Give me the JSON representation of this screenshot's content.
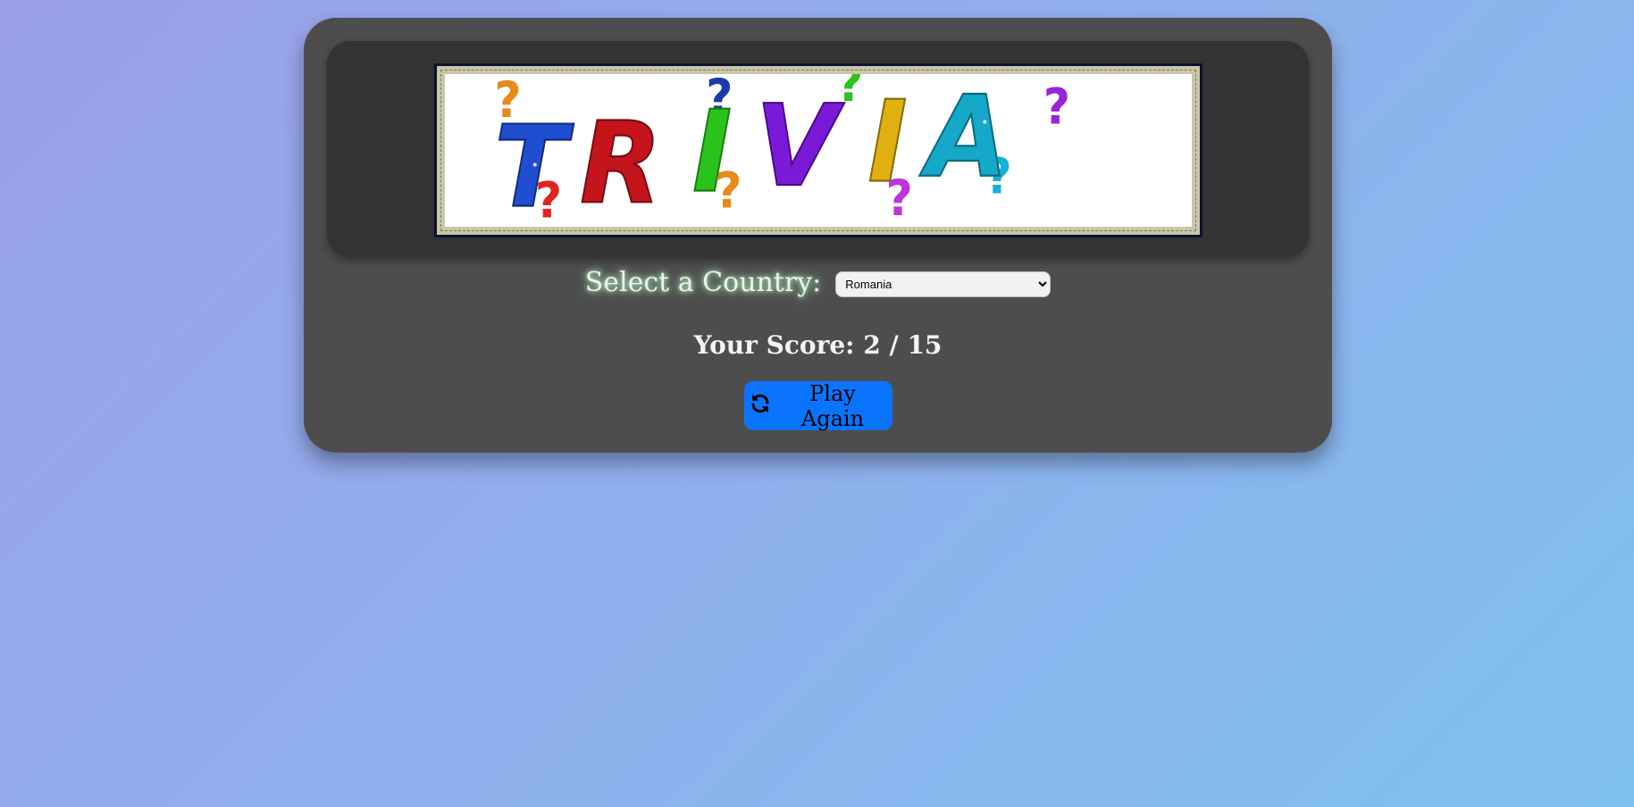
{
  "logo": {
    "text": "TRIVIA",
    "letter_colors": [
      "#1f4fd0",
      "#c4141c",
      "#2cc21c",
      "#7a1ad8",
      "#e0b010",
      "#15a8c8"
    ]
  },
  "country": {
    "label": "Select a Country:",
    "selected": "Romania",
    "options": [
      "Romania"
    ]
  },
  "score": {
    "text": "Your Score: 2 / 15"
  },
  "play_again": {
    "label": "Play Again",
    "icon": "refresh-icon"
  },
  "colors": {
    "button": "#0a74ff",
    "card": "#4d4d4d",
    "banner": "#333333"
  }
}
